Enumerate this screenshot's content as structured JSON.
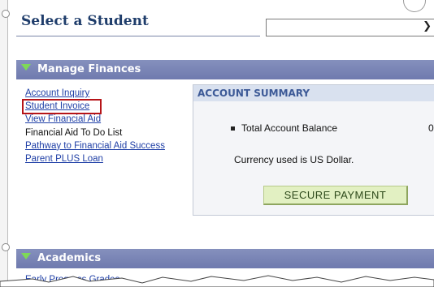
{
  "page": {
    "title": "Select a Student"
  },
  "student_select": {
    "value": ""
  },
  "manage_finances": {
    "header": "Manage Finances",
    "links": [
      {
        "label": "Account Inquiry",
        "link": true
      },
      {
        "label": "Student Invoice",
        "link": true,
        "highlighted": true
      },
      {
        "label": "View Financial Aid",
        "link": true
      },
      {
        "label": "Financial Aid To Do List",
        "link": false
      },
      {
        "label": "Pathway to Financial Aid Success",
        "link": true
      },
      {
        "label": "Parent PLUS Loan",
        "link": true
      }
    ]
  },
  "account_summary": {
    "title": "ACCOUNT SUMMARY",
    "balance_label": "Total Account Balance",
    "balance_value": "0",
    "currency_note": "Currency used is US Dollar.",
    "pay_button": "SECURE PAYMENT"
  },
  "academics": {
    "header": "Academics",
    "first_link": "Early Progress Grades"
  },
  "colors": {
    "section_bar": "#7681b3",
    "link": "#1f3fa6",
    "highlight_border": "#b61418",
    "pay_button": "#e2f0c2"
  }
}
